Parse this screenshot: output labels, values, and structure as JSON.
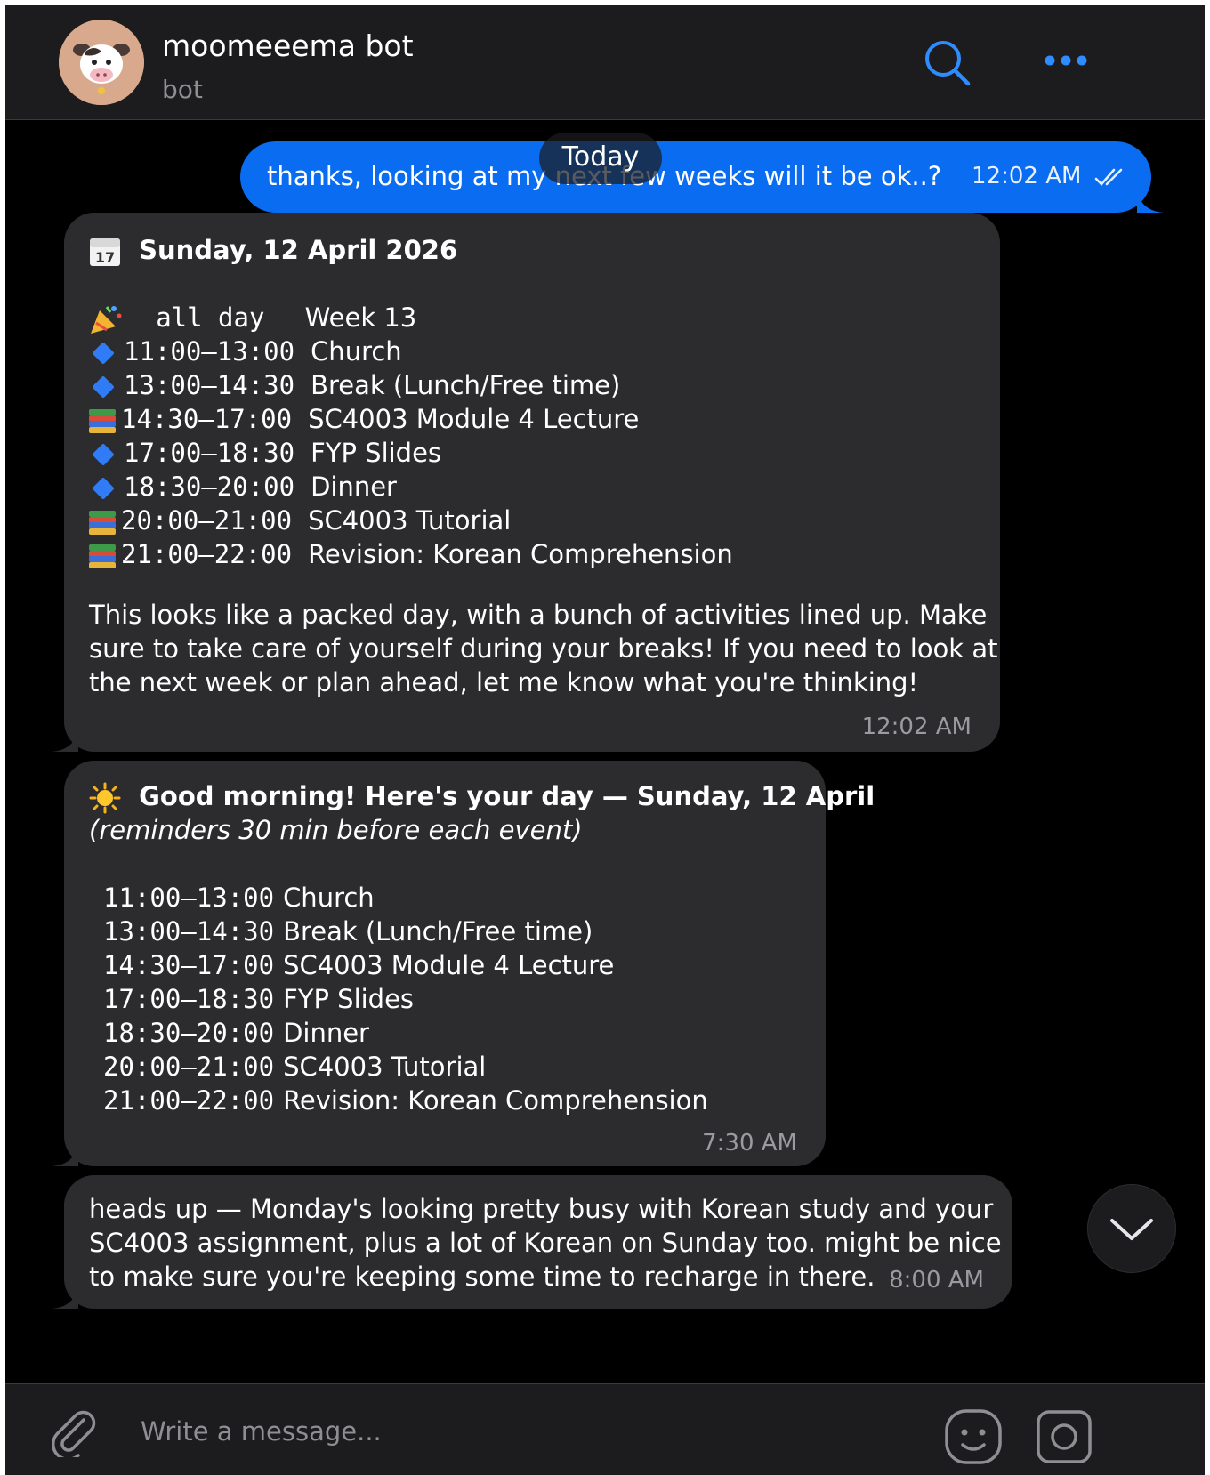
{
  "header": {
    "name": "moomeeema bot",
    "subtitle": "bot"
  },
  "date_pill": "Today",
  "messages": {
    "outgoing": {
      "text": "thanks, looking at my next few weeks will it be ok..?",
      "time": "12:02 AM"
    },
    "schedule": {
      "title": "Sunday, 12 April 2026",
      "allday_label": "all day",
      "allday_event": "Week 13",
      "events": [
        {
          "time": "11:00–13:00",
          "title": "Church",
          "icon": "blue-diamond"
        },
        {
          "time": "13:00–14:30",
          "title": "Break (Lunch/Free time)",
          "icon": "blue-diamond"
        },
        {
          "time": "14:30–17:00",
          "title": "SC4003 Module 4 Lecture",
          "icon": "books"
        },
        {
          "time": "17:00–18:30",
          "title": "FYP Slides",
          "icon": "blue-diamond"
        },
        {
          "time": "18:30–20:00",
          "title": "Dinner",
          "icon": "blue-diamond"
        },
        {
          "time": "20:00–21:00",
          "title": "SC4003 Tutorial",
          "icon": "books"
        },
        {
          "time": "21:00–22:00",
          "title": "Revision: Korean Comprehension",
          "icon": "books"
        }
      ],
      "body": [
        "This looks like a packed day, with a bunch of activities lined up. Make",
        "sure to take care of yourself during your breaks! If you need to look at",
        "the next week or plan ahead, let me know what you're thinking!"
      ],
      "time": "12:02 AM"
    },
    "morning": {
      "title": "Good morning! Here's your day — Sunday, 12 April",
      "subtitle": "(reminders 30 min before each event)",
      "events": [
        {
          "time": "11:00–13:00",
          "title": "Church"
        },
        {
          "time": "13:00–14:30",
          "title": "Break (Lunch/Free time)"
        },
        {
          "time": "14:30–17:00",
          "title": "SC4003 Module 4 Lecture"
        },
        {
          "time": "17:00–18:30",
          "title": "FYP Slides"
        },
        {
          "time": "18:30–20:00",
          "title": "Dinner"
        },
        {
          "time": "20:00–21:00",
          "title": "SC4003 Tutorial"
        },
        {
          "time": "21:00–22:00",
          "title": "Revision: Korean Comprehension"
        }
      ],
      "time": "7:30 AM"
    },
    "headsup": {
      "lines": [
        "heads up — Monday's looking pretty busy with Korean study and your",
        "SC4003 assignment, plus a lot of Korean on Sunday too. might be nice",
        "to make sure you're keeping some time to recharge in there."
      ],
      "time": "8:00 AM"
    }
  },
  "composer": {
    "placeholder": "Write a message..."
  },
  "colors": {
    "accent": "#0a6cf0",
    "bubble": "#2c2c2e",
    "background": "#000000",
    "bar": "#1c1c1e"
  },
  "icons": [
    "search-icon",
    "more-icon",
    "attach-icon",
    "sticker-icon",
    "camera-icon",
    "chevron-down-icon"
  ]
}
